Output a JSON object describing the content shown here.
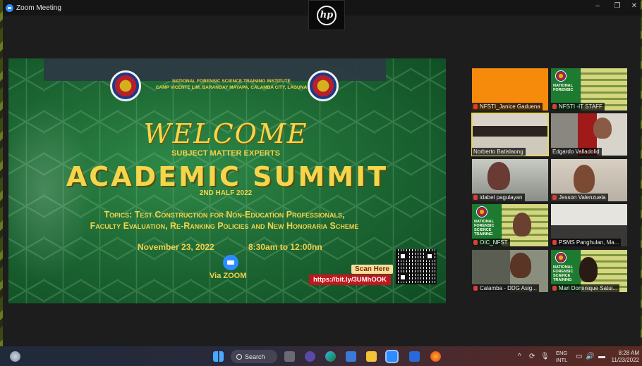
{
  "window": {
    "title": "Zoom Meeting",
    "min_glyph": "–",
    "restore_glyph": "❐",
    "close_glyph": "✕"
  },
  "camera": {
    "logo_text": "hp"
  },
  "slide": {
    "institute_line1": "NATIONAL FORENSIC SCIENCE TRAINING INSTITUTE",
    "institute_line2": "CAMP VICENTE LIM, BARANGAY MAYAPA, CALAMBA CITY, LAGUNA",
    "welcome": "WELCOME",
    "subtitle": "SUBJECT MATTER EXPERTS",
    "title": "ACADEMIC SUMMIT",
    "half": "2ND HALF 2022",
    "topics_line1": "Topics: Test Construction for Non-Education Professionals,",
    "topics_line2": "Faculty Evaluation, Re-Ranking Policies and New Honoraria Scheme",
    "date": "November 23, 2022",
    "time": "8:30am to 12:00nn",
    "via": "Via ZOOM",
    "scan_here": "Scan Here",
    "link": "https://bit.ly/3UMhOOK"
  },
  "participants": [
    {
      "name": "NFSTI_Janice Gaduena"
    },
    {
      "name": "NFSTI -IT STAFF"
    },
    {
      "name": "Norberto Batislaong"
    },
    {
      "name": "Edgardo Valladolid"
    },
    {
      "name": "idabel pagulayan"
    },
    {
      "name": "Jesson Valenzuela"
    },
    {
      "name": "OIC_NFST"
    },
    {
      "name": "PSMS Panghulan, Ma..."
    },
    {
      "name": "Calamba - DDG Asig..."
    },
    {
      "name": "Mari Dominique Satui..."
    }
  ],
  "tile_text": {
    "nfsti_it": "NATIONAL\nFORENSIC",
    "oic": "NATIONAL\nFORENSIC\nSCIENCE\nTRAINING",
    "mari": "NATIONAL\nFORENSIC\nSCIENCE\nTRAINING"
  },
  "taskbar": {
    "search_label": "Search",
    "lang_line1": "ENG",
    "lang_line2": "INTL",
    "time": "8:28 AM",
    "date": "11/23/2022",
    "tray_chevron": "^"
  }
}
